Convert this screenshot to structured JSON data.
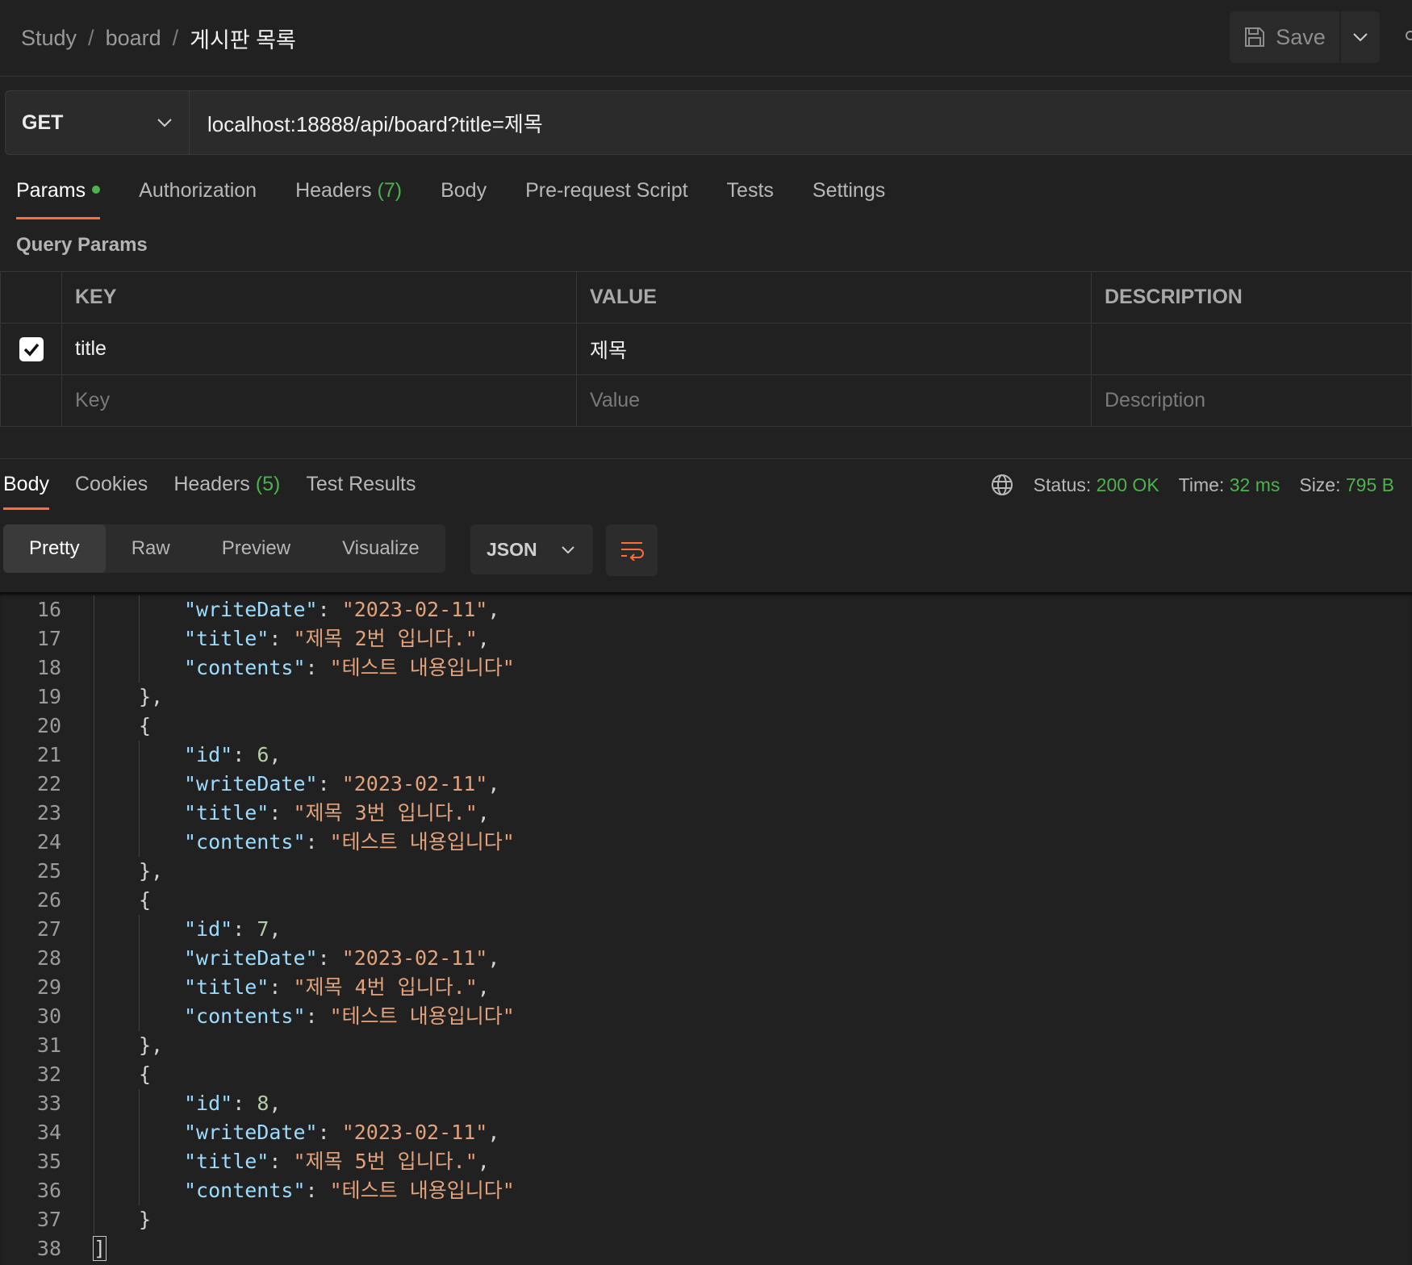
{
  "breadcrumb": {
    "part1": "Study",
    "part2": "board",
    "current": "게시판 목록",
    "sep": "/"
  },
  "toolbar": {
    "save_label": "Save"
  },
  "request": {
    "method": "GET",
    "url": "localhost:18888/api/board?title=제목"
  },
  "request_tabs": {
    "params": "Params",
    "authorization": "Authorization",
    "headers": "Headers",
    "headers_count": "(7)",
    "body": "Body",
    "pre_request": "Pre-request Script",
    "tests": "Tests",
    "settings": "Settings"
  },
  "query_params": {
    "label": "Query Params",
    "headers": {
      "key": "KEY",
      "value": "VALUE",
      "description": "DESCRIPTION"
    },
    "rows": [
      {
        "enabled": true,
        "key": "title",
        "value": "제목",
        "description": ""
      }
    ],
    "placeholders": {
      "key": "Key",
      "value": "Value",
      "description": "Description"
    }
  },
  "response_tabs": {
    "body": "Body",
    "cookies": "Cookies",
    "headers": "Headers",
    "headers_count": "(5)",
    "test_results": "Test Results"
  },
  "response_status": {
    "status_label": "Status:",
    "status_value": "200 OK",
    "time_label": "Time:",
    "time_value": "32 ms",
    "size_label": "Size:",
    "size_value": "795 B"
  },
  "view_modes": {
    "pretty": "Pretty",
    "raw": "Raw",
    "preview": "Preview",
    "visualize": "Visualize"
  },
  "format": {
    "selected": "JSON"
  },
  "colors": {
    "accent": "#ff6c37",
    "success": "#4db24d",
    "background": "#212121",
    "json_key": "#9cdcfe",
    "json_string": "#e3a27b",
    "json_number": "#b5cea8"
  },
  "icons": {
    "save": "save-icon",
    "chevron": "chevron-down-icon",
    "globe": "globe-icon",
    "wrap": "wrap-lines-icon",
    "checkbox": "checkbox-checked-icon"
  },
  "code_lines": [
    {
      "n": "16",
      "indent": 2,
      "key": "writeDate",
      "str": "2023-02-11",
      "trail": ","
    },
    {
      "n": "17",
      "indent": 2,
      "key": "title",
      "str": "제목 2번 입니다.",
      "trail": ","
    },
    {
      "n": "18",
      "indent": 2,
      "key": "contents",
      "str": "테스트 내용입니다",
      "trail": ""
    },
    {
      "n": "19",
      "indent": 1,
      "plain": "},",
      "guides": 1
    },
    {
      "n": "20",
      "indent": 1,
      "plain": "{",
      "guides": 1
    },
    {
      "n": "21",
      "indent": 2,
      "key": "id",
      "num": "6",
      "trail": ","
    },
    {
      "n": "22",
      "indent": 2,
      "key": "writeDate",
      "str": "2023-02-11",
      "trail": ","
    },
    {
      "n": "23",
      "indent": 2,
      "key": "title",
      "str": "제목 3번 입니다.",
      "trail": ","
    },
    {
      "n": "24",
      "indent": 2,
      "key": "contents",
      "str": "테스트 내용입니다",
      "trail": ""
    },
    {
      "n": "25",
      "indent": 1,
      "plain": "},",
      "guides": 1
    },
    {
      "n": "26",
      "indent": 1,
      "plain": "{",
      "guides": 1
    },
    {
      "n": "27",
      "indent": 2,
      "key": "id",
      "num": "7",
      "trail": ","
    },
    {
      "n": "28",
      "indent": 2,
      "key": "writeDate",
      "str": "2023-02-11",
      "trail": ","
    },
    {
      "n": "29",
      "indent": 2,
      "key": "title",
      "str": "제목 4번 입니다.",
      "trail": ","
    },
    {
      "n": "30",
      "indent": 2,
      "key": "contents",
      "str": "테스트 내용입니다",
      "trail": ""
    },
    {
      "n": "31",
      "indent": 1,
      "plain": "},",
      "guides": 1
    },
    {
      "n": "32",
      "indent": 1,
      "plain": "{",
      "guides": 1
    },
    {
      "n": "33",
      "indent": 2,
      "key": "id",
      "num": "8",
      "trail": ","
    },
    {
      "n": "34",
      "indent": 2,
      "key": "writeDate",
      "str": "2023-02-11",
      "trail": ","
    },
    {
      "n": "35",
      "indent": 2,
      "key": "title",
      "str": "제목 5번 입니다.",
      "trail": ","
    },
    {
      "n": "36",
      "indent": 2,
      "key": "contents",
      "str": "테스트 내용입니다",
      "trail": ""
    },
    {
      "n": "37",
      "indent": 1,
      "plain": "}",
      "guides": 1
    },
    {
      "n": "38",
      "indent": 0,
      "plain": "]",
      "guides": 0,
      "boxed": true
    }
  ]
}
